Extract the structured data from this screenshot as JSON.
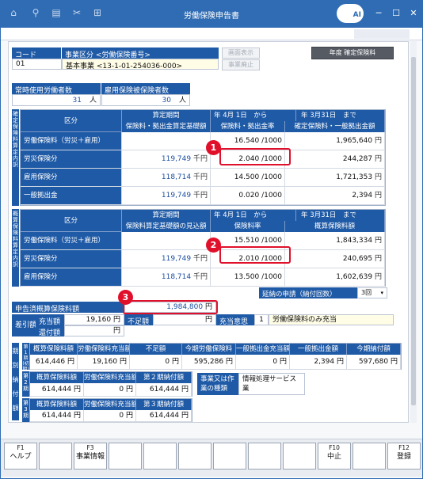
{
  "window": {
    "title": "労働保険申告書",
    "badge": "AI"
  },
  "top": {
    "code_label": "コード",
    "office_label": "事業区分 <労働保険番号>",
    "code_value": "01",
    "office_value": "基本事業 <13-1-01-254036-000>",
    "btn_screen": "画面表示",
    "btn_abolish": "事業廃止",
    "btn_year": "年度 確定保険料"
  },
  "workers": {
    "regular_label": "常時使用労働者数",
    "insured_label": "雇用保険被保険者数",
    "regular_value": "31",
    "insured_value": "30",
    "unit": "人"
  },
  "confirmed": {
    "side_label": "確定保険料算定内訳",
    "category": "区分",
    "period_label": "算定期間",
    "from": "年 4月 1日　から",
    "to": "年 3月31日　まで",
    "col1": "保険料・拠出金算定基礎額",
    "col2": "保険料・拠出金率",
    "col3": "確定保険料・一般拠出金額",
    "rows": [
      {
        "name": "労働保険料（労災＋雇用）",
        "base": "",
        "base_unit": "",
        "rate": "16.540",
        "rate_unit": "/1000",
        "amount": "1,965,640",
        "amount_unit": "円"
      },
      {
        "name": "労災保険分",
        "base": "119,749",
        "base_unit": "千円",
        "rate": "2.040",
        "rate_unit": "/1000",
        "amount": "244,287",
        "amount_unit": "円"
      },
      {
        "name": "雇用保険分",
        "base": "118,714",
        "base_unit": "千円",
        "rate": "14.500",
        "rate_unit": "/1000",
        "amount": "1,721,353",
        "amount_unit": "円"
      },
      {
        "name": "一般拠出金",
        "base": "119,749",
        "base_unit": "千円",
        "rate": "0.020",
        "rate_unit": "/1000",
        "amount": "2,394",
        "amount_unit": "円"
      }
    ]
  },
  "estimated": {
    "side_label": "概算保険料算定内訳",
    "category": "区分",
    "period_label": "算定期間",
    "from": "年 4月 1日　から",
    "to": "年 3月31日　まで",
    "col1": "保険料算定基礎額の見込額",
    "col2": "保険料率",
    "col3": "概算保険料額",
    "rows": [
      {
        "name": "労働保険料（労災＋雇用）",
        "base": "",
        "base_unit": "",
        "rate": "15.510",
        "rate_unit": "/1000",
        "amount": "1,843,334",
        "amount_unit": "円"
      },
      {
        "name": "労災保険分",
        "base": "119,749",
        "base_unit": "千円",
        "rate": "2.010",
        "rate_unit": "/1000",
        "amount": "240,695",
        "amount_unit": "円"
      },
      {
        "name": "雇用保険分",
        "base": "118,714",
        "base_unit": "千円",
        "rate": "13.500",
        "rate_unit": "/1000",
        "amount": "1,602,639",
        "amount_unit": "円"
      }
    ]
  },
  "deferral": {
    "label": "延納の申請（納付回数）",
    "value": "3回"
  },
  "declared": {
    "label": "申告済概算保険料額",
    "value": "1,984,800",
    "unit": "円"
  },
  "balance": {
    "label": "差引額",
    "surplus_label": "充当額",
    "surplus_value": "19,160",
    "refund_label": "還付額",
    "refund_value": "",
    "shortage_label": "不足額",
    "shortage_value": "",
    "intent_label": "充当意思",
    "intent_code": "1",
    "intent_text": "労働保険料のみ充当",
    "unit": "円"
  },
  "installments": {
    "side_label": "期別納付額",
    "p1_label": "第1期(初期)",
    "p1_headers": [
      "概算保険料額",
      "労働保険料充当額",
      "不足額",
      "今期労働保険料",
      "一般拠出金充当額",
      "一般拠出金額",
      "今期納付額"
    ],
    "p1_values": [
      "614,446",
      "19,160",
      "0",
      "595,286",
      "0",
      "2,394",
      "597,680"
    ],
    "p2_label": "第2期",
    "p2_headers": [
      "概算保険料額",
      "労働保険料充当額",
      "第２期納付額"
    ],
    "p2_values": [
      "614,444",
      "0",
      "614,444"
    ],
    "p3_label": "第3期",
    "p3_headers": [
      "概算保険料額",
      "労働保険料充当額",
      "第３期納付額"
    ],
    "p3_values": [
      "614,444",
      "0",
      "614,444"
    ],
    "biz_label": "事業又は作業の種類",
    "biz_value": "情報処理サービス業",
    "unit": "円"
  },
  "callouts": [
    "1",
    "2",
    "3"
  ],
  "fkeys": [
    {
      "key": "F1",
      "label": "ヘルプ"
    },
    {
      "key": "",
      "label": ""
    },
    {
      "key": "F3",
      "label": "事業情報"
    },
    {
      "key": "",
      "label": ""
    },
    {
      "key": "",
      "label": ""
    },
    {
      "key": "",
      "label": ""
    },
    {
      "key": "",
      "label": ""
    },
    {
      "key": "",
      "label": ""
    },
    {
      "key": "",
      "label": ""
    },
    {
      "key": "F10",
      "label": "中止"
    },
    {
      "key": "",
      "label": ""
    },
    {
      "key": "F12",
      "label": "登録"
    }
  ]
}
